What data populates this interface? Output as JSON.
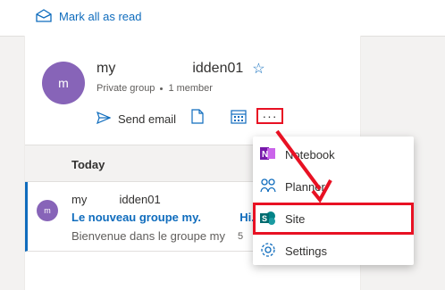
{
  "toolbar": {
    "mark_all_label": "Mark all as read"
  },
  "group": {
    "avatar_initial": "m",
    "name_prefix": "my",
    "name_suffix": "idden01",
    "type": "Private group",
    "members": "1 member",
    "send_email_label": "Send email",
    "more_label": "···"
  },
  "list": {
    "section_label": "Today"
  },
  "message": {
    "avatar_initial": "m",
    "sender": "my          idden01",
    "subject": "Le nouveau groupe my.            Hi..",
    "preview": "Bienvenue dans le groupe my",
    "date": "5"
  },
  "menu": {
    "items": [
      {
        "label": "Notebook",
        "icon": "onenote-icon"
      },
      {
        "label": "Planner",
        "icon": "planner-icon"
      },
      {
        "label": "Site",
        "icon": "sharepoint-icon",
        "highlighted": true
      },
      {
        "label": "Settings",
        "icon": "gear-icon"
      }
    ]
  },
  "colors": {
    "accent": "#0f6cbd",
    "annotation": "#e81123",
    "avatar": "#8764b8"
  }
}
